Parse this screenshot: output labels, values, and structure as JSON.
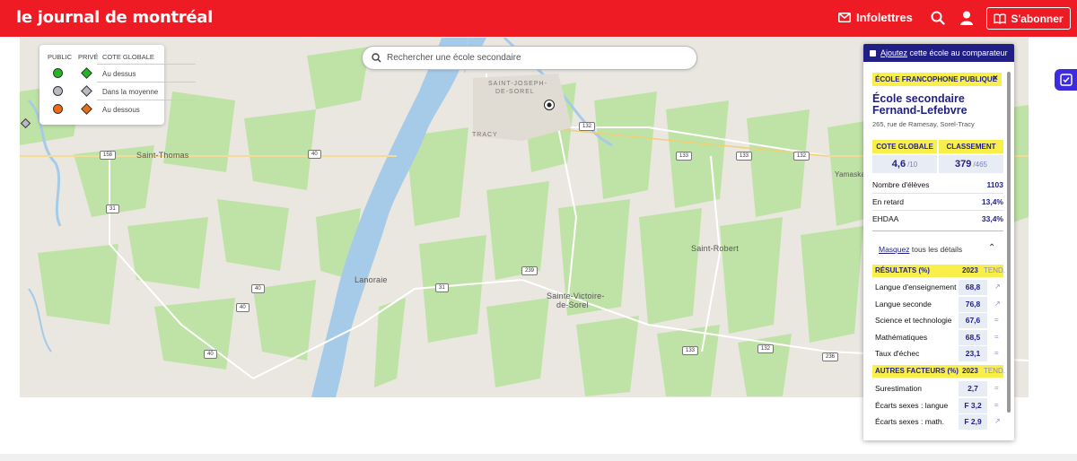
{
  "header": {
    "logo": "le journal de montréal",
    "infolettres": "Infolettres",
    "subscribe": "S'abonner",
    "bg_color": "#ee1b24"
  },
  "legend": {
    "col_public": "PUBLIC",
    "col_prive": "PRIVÉ",
    "col_cote": "COTE GLOBALE",
    "rows": [
      {
        "label": "Au dessus",
        "color": "#22b722"
      },
      {
        "label": "Dans la moyenne",
        "color": "#b9b9c4"
      },
      {
        "label": "Au dessous",
        "color": "#ee6a14"
      }
    ]
  },
  "search": {
    "placeholder": "Rechercher une école secondaire"
  },
  "map": {
    "places": {
      "saint_thomas": "Saint-Thomas",
      "lanoraie": "Lanoraie",
      "saint_robert": "Saint-Robert",
      "sainte_victoire_1": "Sainte-Victoire-",
      "sainte_victoire_2": "de-Sorel",
      "saint_joseph_1": "SAINT-JOSEPH-",
      "saint_joseph_2": "DE-SOREL",
      "tracy": "TRACY",
      "yamaska": "Yamaska"
    },
    "shields": [
      "158",
      "40",
      "31",
      "40",
      "40",
      "40",
      "31",
      "239",
      "132",
      "133",
      "133",
      "132",
      "133",
      "132",
      "236"
    ]
  },
  "panel": {
    "compare": "Ajoutez",
    "compare_rest": " cette école au comparateur",
    "type": "ÉCOLE FRANCOPHONE PUBLIQUE",
    "close": "×",
    "name": "École secondaire Fernand-Lefebvre",
    "address": "265, rue de Ramesay, Sorel-Tracy",
    "cote_label": "COTE GLOBALE",
    "classement_label": "CLASSEMENT",
    "cote_value": "4,6",
    "cote_max": "/10",
    "classement_value": "379",
    "classement_max": "/465",
    "stats": [
      {
        "label": "Nombre d'élèves",
        "value": "1103"
      },
      {
        "label": "En retard",
        "value": "13,4%"
      },
      {
        "label": "EHDAA",
        "value": "33,4%"
      }
    ],
    "masquez": "Masquez",
    "masquez_rest": " tous les détails",
    "resultats": {
      "title": "RÉSULTATS (%)",
      "year": "2023",
      "tend": "TEND.",
      "rows": [
        {
          "label": "Langue d'enseignement",
          "value": "68,8",
          "trend": "↗"
        },
        {
          "label": "Langue seconde",
          "value": "76,8",
          "trend": "↗"
        },
        {
          "label": "Science et technologie",
          "value": "67,6",
          "trend": "="
        },
        {
          "label": "Mathématiques",
          "value": "68,5",
          "trend": "="
        },
        {
          "label": "Taux d'échec",
          "value": "23,1",
          "trend": "="
        }
      ]
    },
    "autres": {
      "title": "AUTRES FACTEURS (%)",
      "year": "2023",
      "tend": "TEND.",
      "rows": [
        {
          "label": "Surestimation",
          "value": "2,7",
          "trend": "="
        },
        {
          "label": "Écarts sexes : langue",
          "value": "F 3,2",
          "trend": "="
        },
        {
          "label": "Écarts sexes : math.",
          "value": "F 2,9",
          "trend": "↗"
        }
      ]
    }
  }
}
